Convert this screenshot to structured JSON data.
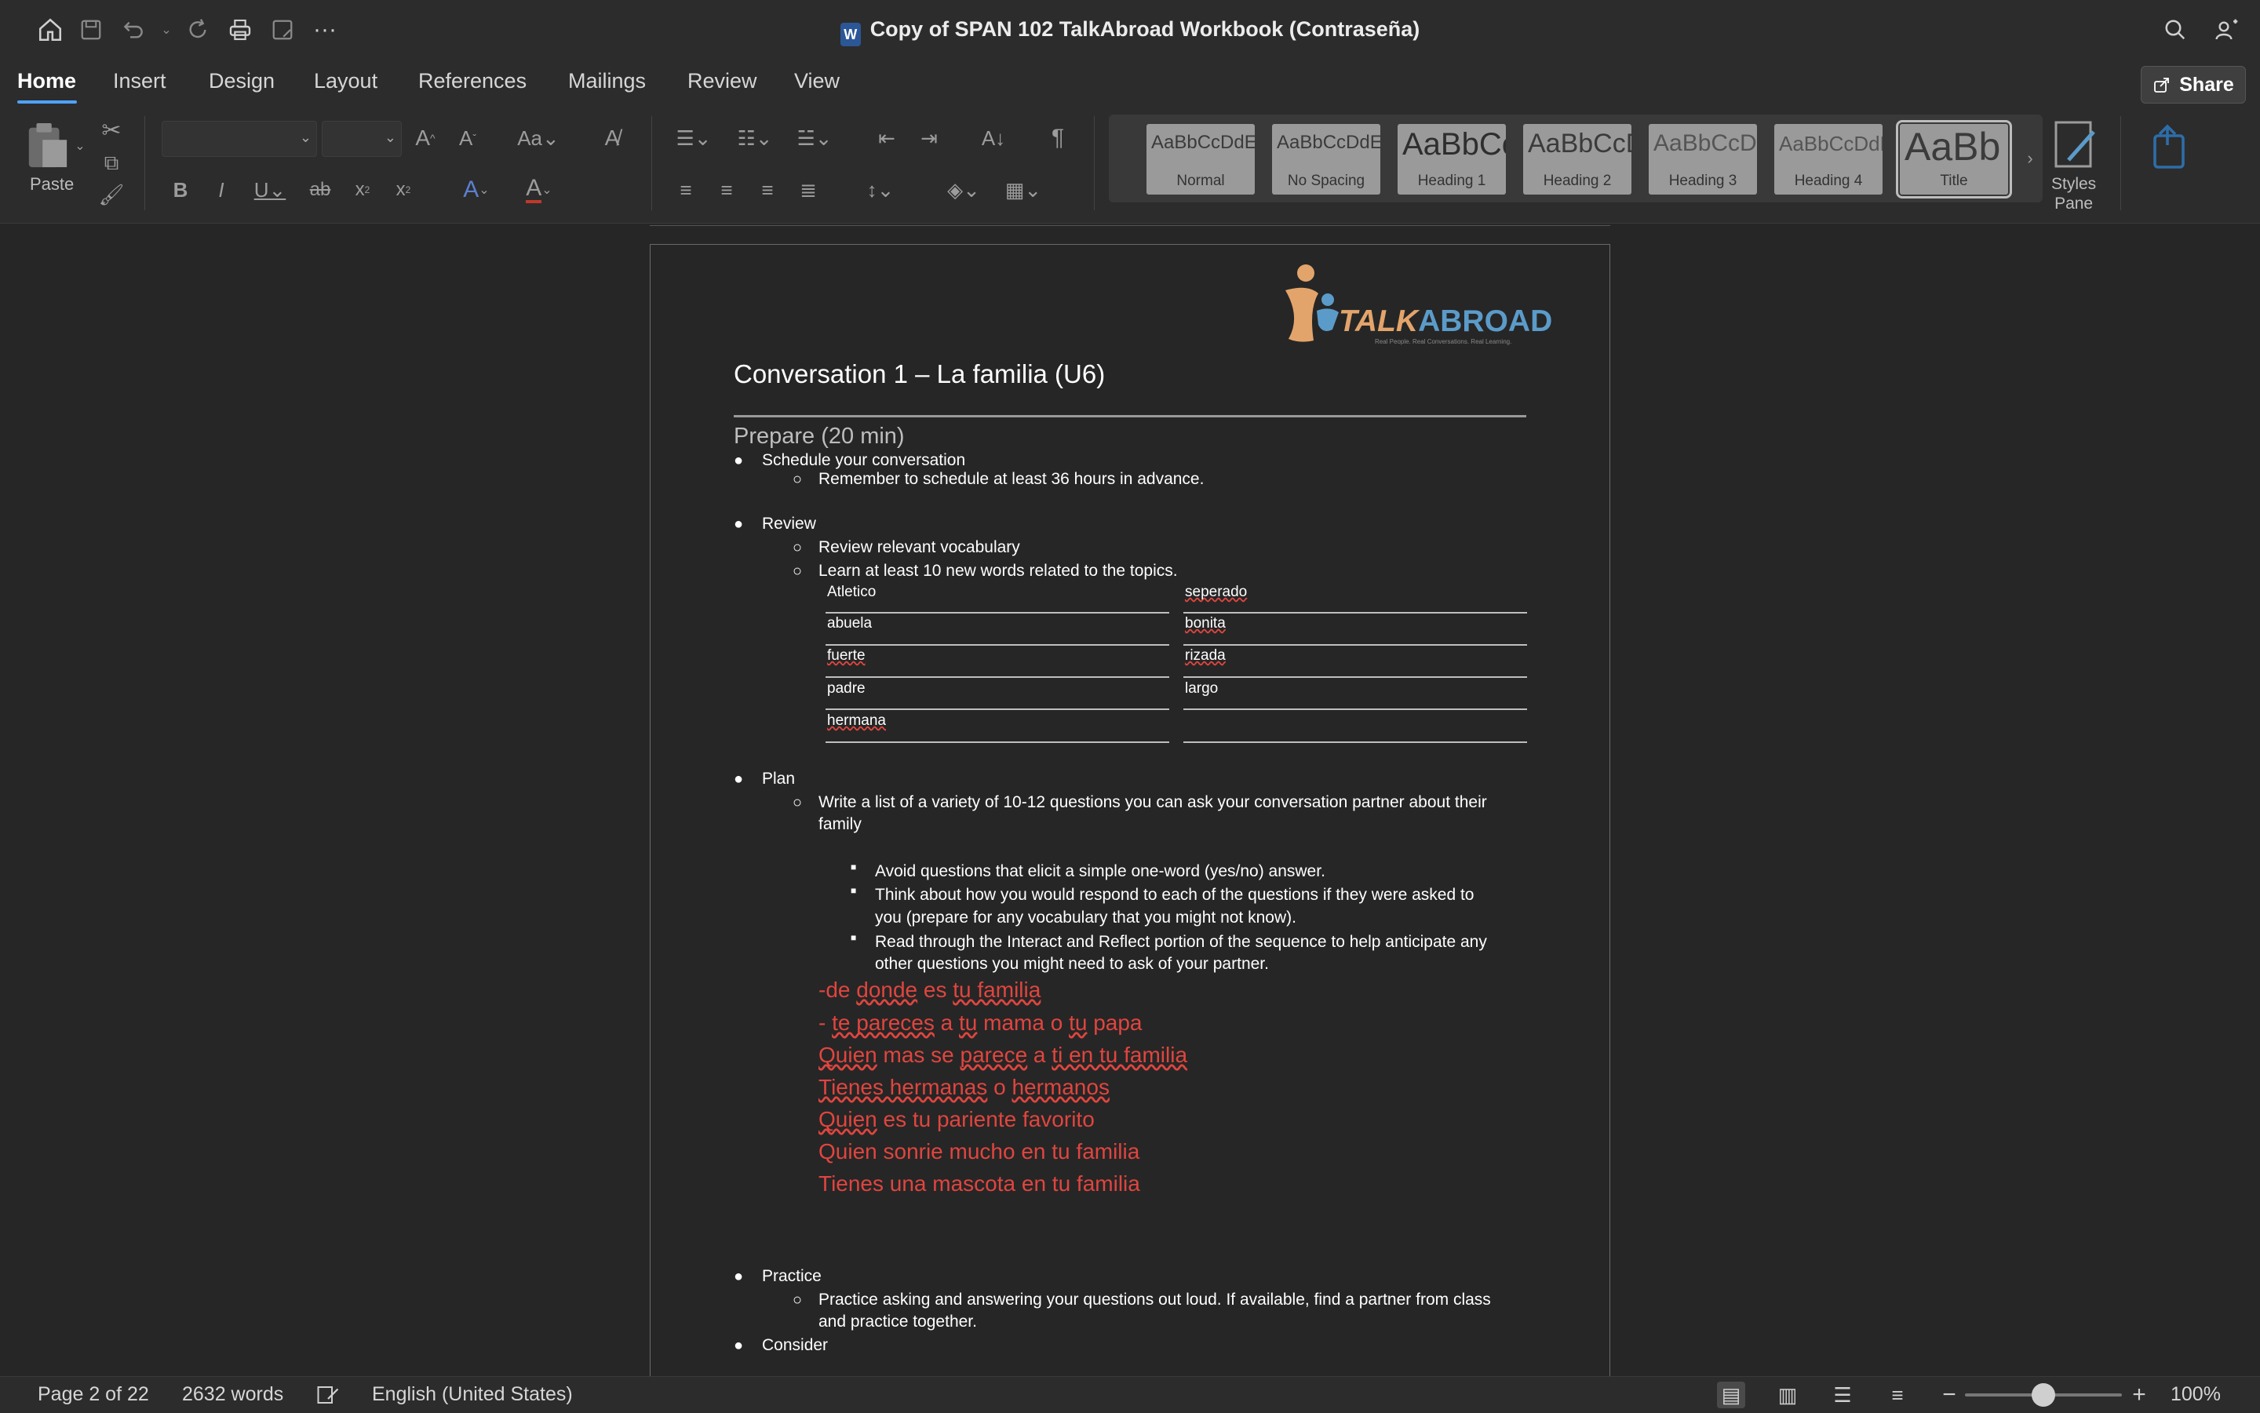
{
  "window": {
    "title": "Copy of SPAN 102 TalkAbroad Workbook (Contraseña)",
    "app_badge": "W"
  },
  "ribbon_tabs": [
    "Home",
    "Insert",
    "Design",
    "Layout",
    "References",
    "Mailings",
    "Review",
    "View"
  ],
  "active_tab": "Home",
  "share_label": "Share",
  "clipboard": {
    "paste_label": "Paste"
  },
  "styles": [
    {
      "preview": "AaBbCcDdEe",
      "label": "Normal"
    },
    {
      "preview": "AaBbCcDdEe",
      "label": "No Spacing"
    },
    {
      "preview": "AaBbCc",
      "label": "Heading 1"
    },
    {
      "preview": "AaBbCcD",
      "label": "Heading 2"
    },
    {
      "preview": "AaBbCcDc",
      "label": "Heading 3"
    },
    {
      "preview": "AaBbCcDdE",
      "label": "Heading 4"
    },
    {
      "preview": "AaBb",
      "label": "Title"
    }
  ],
  "styles_pane_label": "Styles\nPane",
  "document": {
    "logo": {
      "talk": "TALK",
      "abroad": "ABROAD",
      "tagline": "Real People. Real Conversations. Real Learning."
    },
    "heading": "Conversation 1 – La familia (U6)",
    "prepare_heading": "Prepare (20 min)",
    "schedule": "Schedule your conversation",
    "schedule_sub": "Remember to schedule at least 36 hours in advance.",
    "review": "Review",
    "review_sub1": "Review relevant vocabulary",
    "review_sub2": "Learn at least 10 new words related to the topics.",
    "vocab_left": [
      "Atletico",
      "abuela",
      "fuerte",
      "padre",
      "hermana"
    ],
    "vocab_right": [
      "seperado",
      "bonita",
      "rizada",
      "largo",
      ""
    ],
    "plan": "Plan",
    "plan_sub": "Write a list of a variety of 10-12 questions you can ask your conversation partner about their family",
    "plan_sub_line1": "Write a list of a variety of 10-12 questions you can ask your conversation partner about their",
    "plan_sub_line2": "family",
    "plan_points": [
      {
        "l1": "Avoid questions that elicit a simple one-word (yes/no) answer.",
        "l2": ""
      },
      {
        "l1": "Think about how you would respond to each of the questions if they were asked to",
        "l2": "you (prepare for any vocabulary that you might not know)."
      },
      {
        "l1": "Read through the Interact and Reflect portion of the sequence to help anticipate any",
        "l2": "other questions you might need to ask of your partner."
      }
    ],
    "questions": [
      "-de donde es tu familia",
      "- te pareces a tu mama o tu papa",
      "Quien mas se parece a ti en tu familia",
      "Tienes hermanas o hermanos",
      "Quien es tu pariente favorito",
      "Quien sonrie mucho en tu familia",
      "Tienes una mascota en tu familia"
    ],
    "practice": "Practice",
    "practice_line1": "Practice asking and answering your questions out loud. If available, find a partner from class",
    "practice_line2": "and practice together.",
    "consider": "Consider"
  },
  "status": {
    "page": "Page 2 of 22",
    "words": "2632 words",
    "language": "English (United States)",
    "zoom": "100%",
    "zoom_level": 0.5
  },
  "colors": {
    "accent": "#4fa3ff",
    "red_text": "#e0453f",
    "logo_orange": "#e3a46b",
    "logo_blue": "#5b9bc9"
  }
}
